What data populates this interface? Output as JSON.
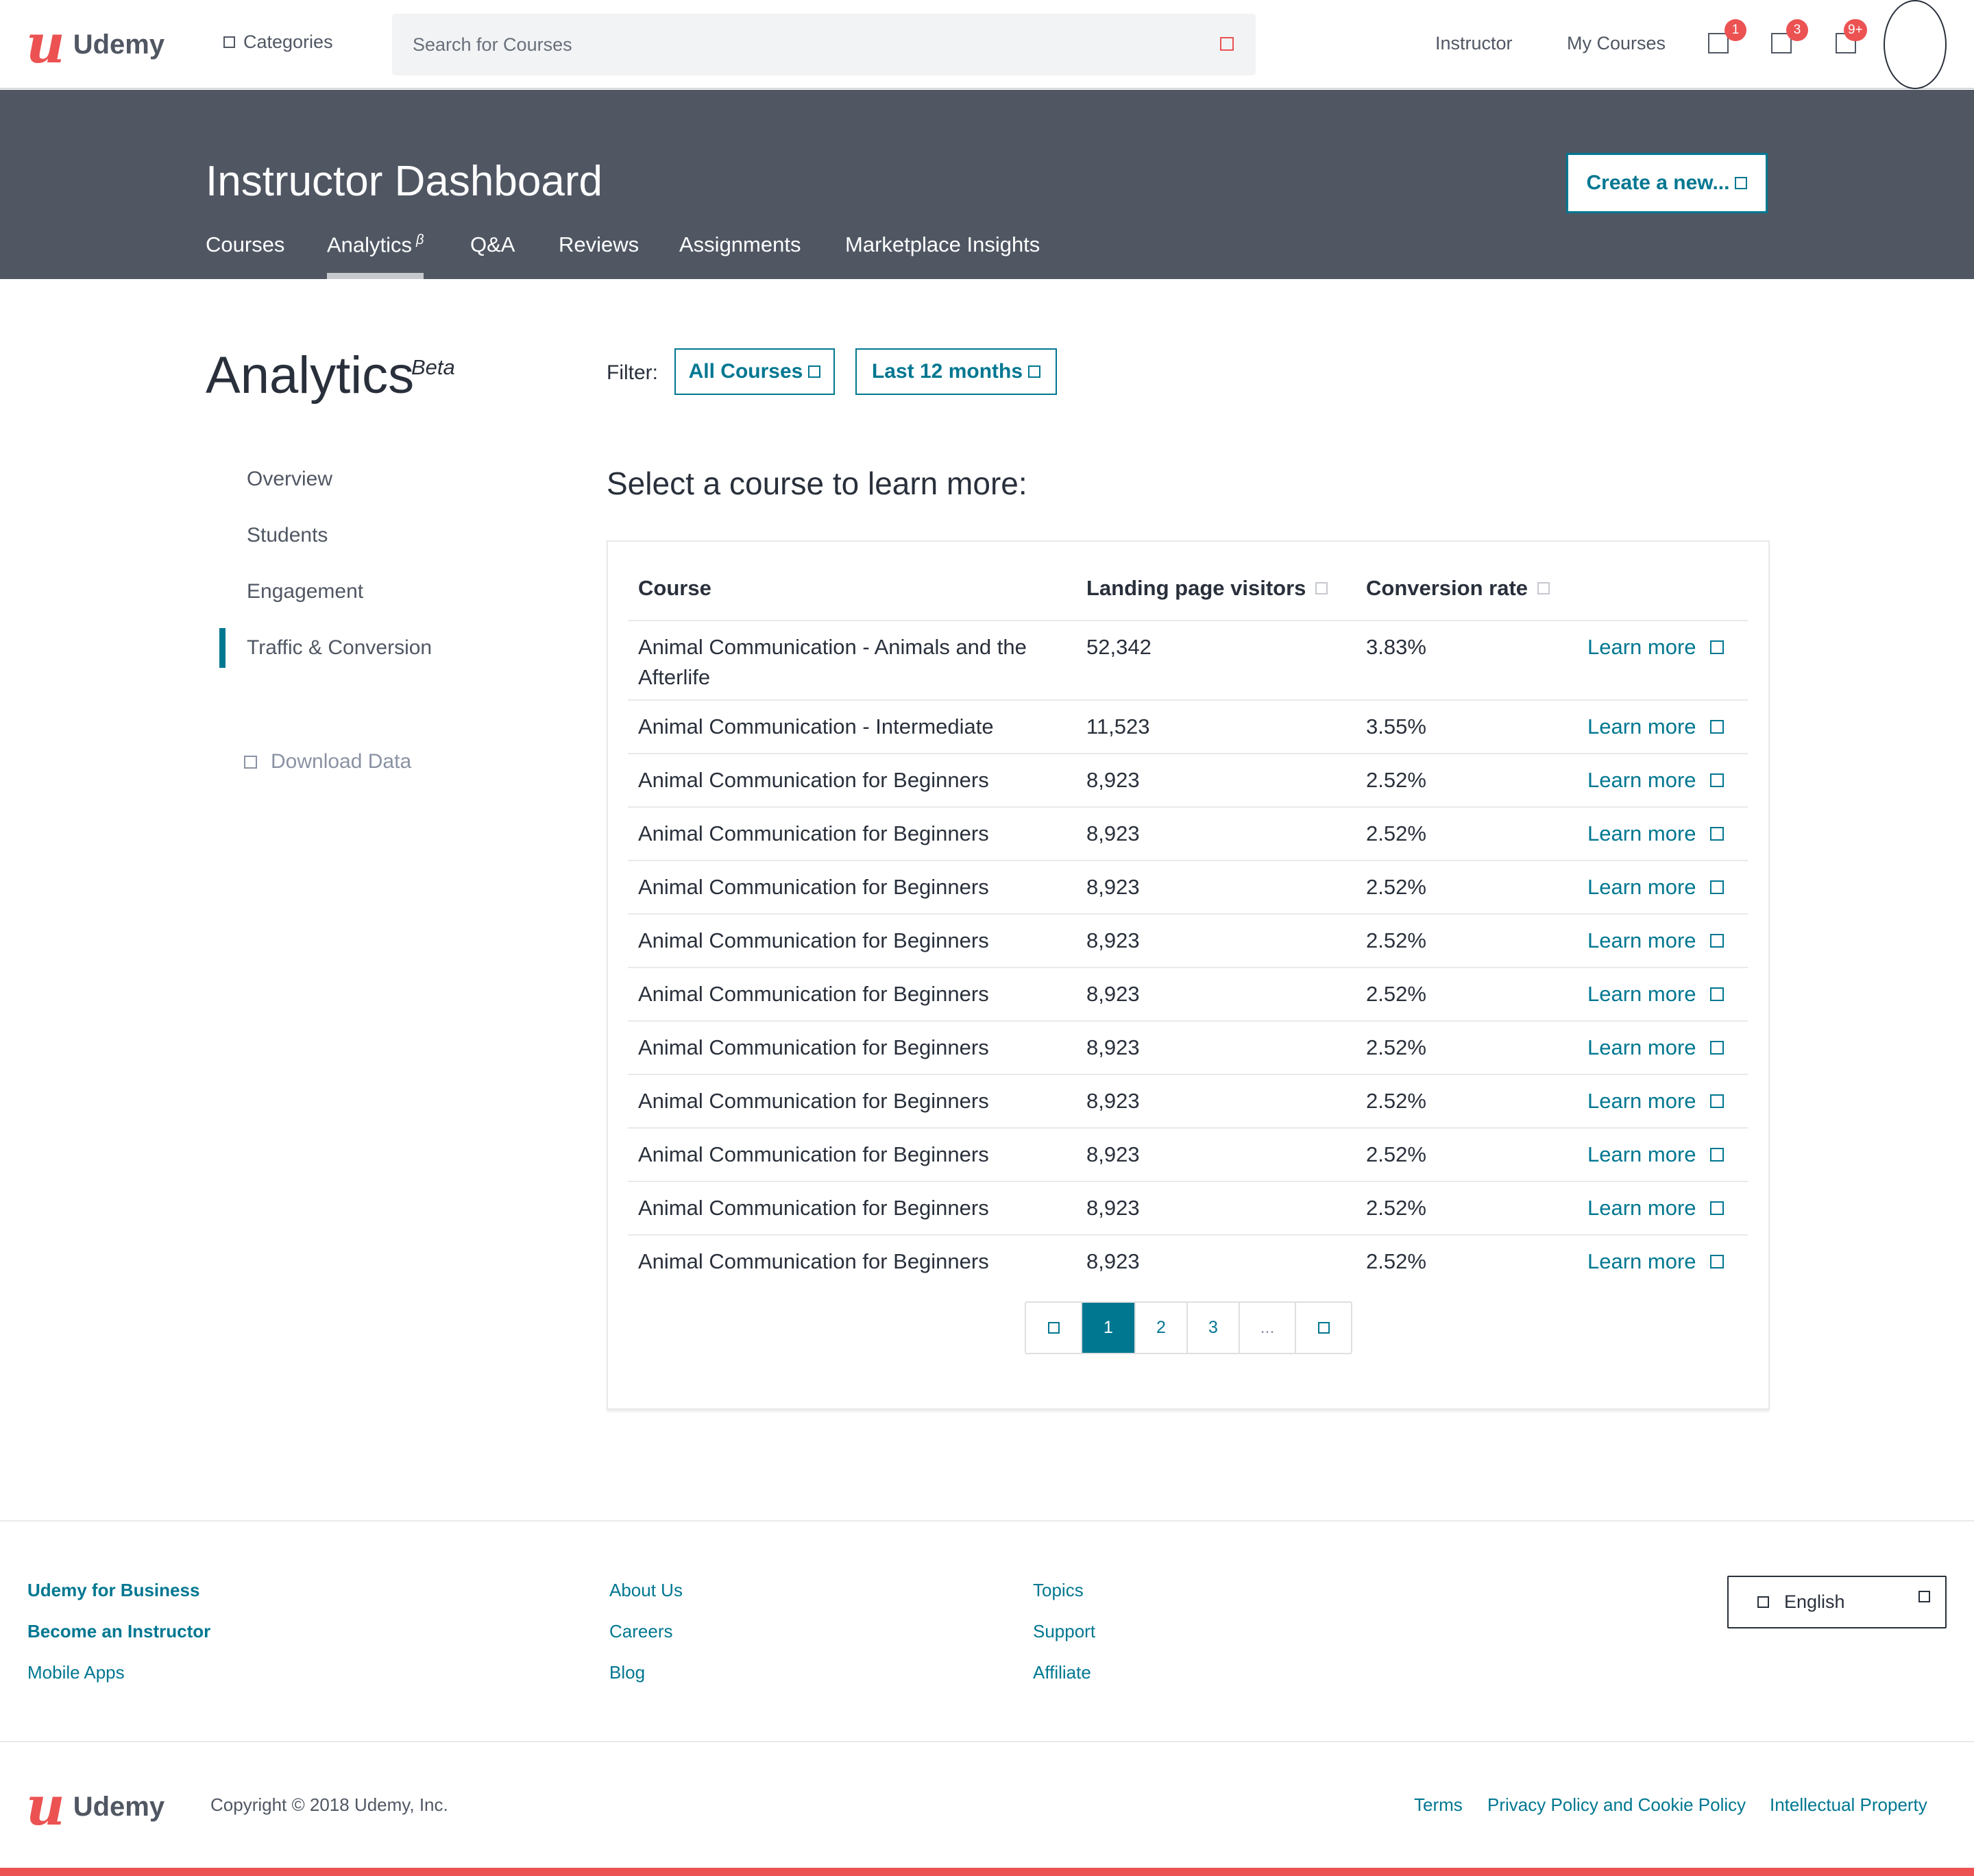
{
  "header": {
    "logo_mark": "u",
    "logo_text": "Udemy",
    "categories_label": "Categories",
    "search_placeholder": "Search for Courses",
    "instructor_link": "Instructor",
    "my_courses_link": "My Courses",
    "badges": {
      "cart": "1",
      "messages": "3",
      "notifications": "9+"
    }
  },
  "dashboard": {
    "title": "Instructor Dashboard",
    "create_button": "Create a new...",
    "tabs": [
      {
        "label": "Courses"
      },
      {
        "label": "Analytics",
        "sup": "β"
      },
      {
        "label": "Q&A"
      },
      {
        "label": "Reviews"
      },
      {
        "label": "Assignments"
      },
      {
        "label": "Marketplace Insights"
      }
    ]
  },
  "sidebar": {
    "heading": "Analytics",
    "beta": "Beta",
    "items": [
      "Overview",
      "Students",
      "Engagement",
      "Traffic & Conversion"
    ],
    "download": "Download Data"
  },
  "filter": {
    "label": "Filter:",
    "courses": "All Courses",
    "period": "Last 12 months"
  },
  "main": {
    "heading": "Select a course to learn more:",
    "table": {
      "headers": [
        "Course",
        "Landing page visitors",
        "Conversion rate"
      ],
      "link_label": "Learn more",
      "rows": [
        {
          "course": "Animal Communication - Animals and the Afterlife",
          "visitors": "52,342",
          "rate": "3.83%"
        },
        {
          "course": "Animal Communication - Intermediate",
          "visitors": "11,523",
          "rate": "3.55%"
        },
        {
          "course": "Animal Communication for Beginners",
          "visitors": "8,923",
          "rate": "2.52%"
        },
        {
          "course": "Animal Communication for Beginners",
          "visitors": "8,923",
          "rate": "2.52%"
        },
        {
          "course": "Animal Communication for Beginners",
          "visitors": "8,923",
          "rate": "2.52%"
        },
        {
          "course": "Animal Communication for Beginners",
          "visitors": "8,923",
          "rate": "2.52%"
        },
        {
          "course": "Animal Communication for Beginners",
          "visitors": "8,923",
          "rate": "2.52%"
        },
        {
          "course": "Animal Communication for Beginners",
          "visitors": "8,923",
          "rate": "2.52%"
        },
        {
          "course": "Animal Communication for Beginners",
          "visitors": "8,923",
          "rate": "2.52%"
        },
        {
          "course": "Animal Communication for Beginners",
          "visitors": "8,923",
          "rate": "2.52%"
        },
        {
          "course": "Animal Communication for Beginners",
          "visitors": "8,923",
          "rate": "2.52%"
        },
        {
          "course": "Animal Communication for Beginners",
          "visitors": "8,923",
          "rate": "2.52%"
        }
      ]
    },
    "pagination": {
      "pages": [
        "1",
        "2",
        "3"
      ],
      "ellipsis": "...",
      "current": "1"
    }
  },
  "footer": {
    "col1": [
      "Udemy for Business",
      "Become an Instructor",
      "Mobile Apps"
    ],
    "col2": [
      "About Us",
      "Careers",
      "Blog"
    ],
    "col3": [
      "Topics",
      "Support",
      "Affiliate"
    ],
    "language": "English",
    "copyright": "Copyright © 2018 Udemy, Inc.",
    "legal": [
      "Terms",
      "Privacy Policy and Cookie Policy",
      "Intellectual Property"
    ]
  },
  "colors": {
    "accent": "#007791",
    "brand": "#ec5252",
    "header_bg": "#505763"
  }
}
